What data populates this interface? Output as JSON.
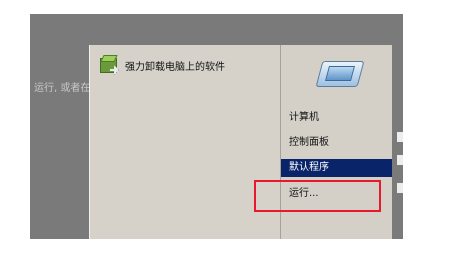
{
  "background": {
    "partial_text": "运行, 或者在"
  },
  "start_menu": {
    "pinned_item": {
      "label": "强力卸载电脑上的软件",
      "icon": "uninstall-box-icon"
    },
    "right_pane": {
      "header_icon": "computer-icon",
      "items": [
        {
          "label": "计算机",
          "selected": false
        },
        {
          "label": "控制面板",
          "selected": false
        },
        {
          "label": "默认程序",
          "selected": true
        },
        {
          "label": "运行...",
          "selected": false
        }
      ]
    }
  },
  "annotation": {
    "color": "#e8192c",
    "target": "运行..."
  },
  "colors": {
    "menu_bg": "#d4d0c8",
    "selection": "#0a246a",
    "backdrop": "#7a7a7a"
  }
}
